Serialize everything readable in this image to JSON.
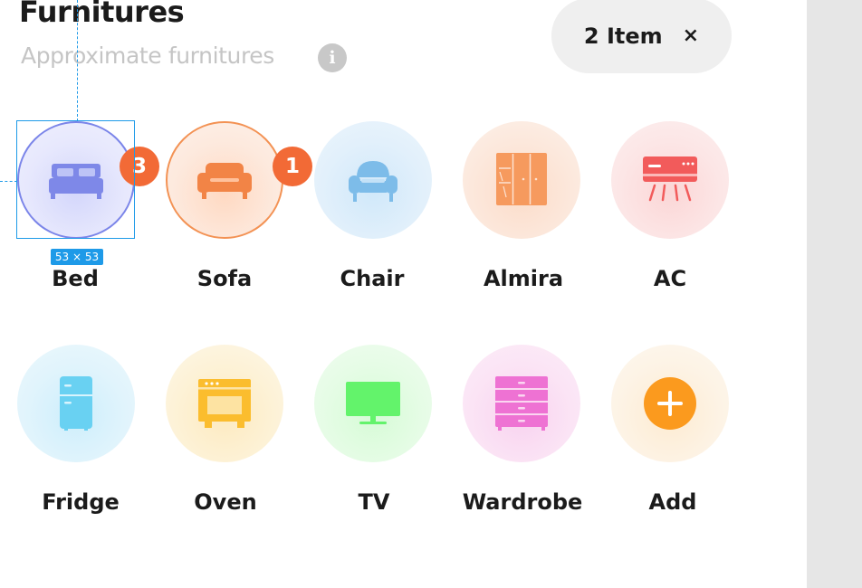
{
  "header": {
    "title": "Furnitures",
    "subtitle": "Approximate furnitures",
    "info_icon": "i"
  },
  "selection_chip": {
    "label": "2 Item",
    "close": "×"
  },
  "items": [
    {
      "label": "Bed",
      "icon": "bed-icon",
      "badge": "3",
      "selected": true
    },
    {
      "label": "Sofa",
      "icon": "sofa-icon",
      "badge": "1",
      "selected": true
    },
    {
      "label": "Chair",
      "icon": "armchair-icon"
    },
    {
      "label": "Almira",
      "icon": "almira-icon"
    },
    {
      "label": "AC",
      "icon": "air-conditioner-icon"
    },
    {
      "label": "Fridge",
      "icon": "fridge-icon"
    },
    {
      "label": "Oven",
      "icon": "oven-icon"
    },
    {
      "label": "TV",
      "icon": "tv-icon"
    },
    {
      "label": "Wardrobe",
      "icon": "wardrobe-icon"
    },
    {
      "label": "Add",
      "icon": "plus-icon"
    }
  ],
  "design_overlay": {
    "size_label": "53 × 53"
  },
  "colors": {
    "badge": "#f26a36",
    "selection_guide": "#1e9ae8",
    "side_panel": "#e6e6e6"
  }
}
